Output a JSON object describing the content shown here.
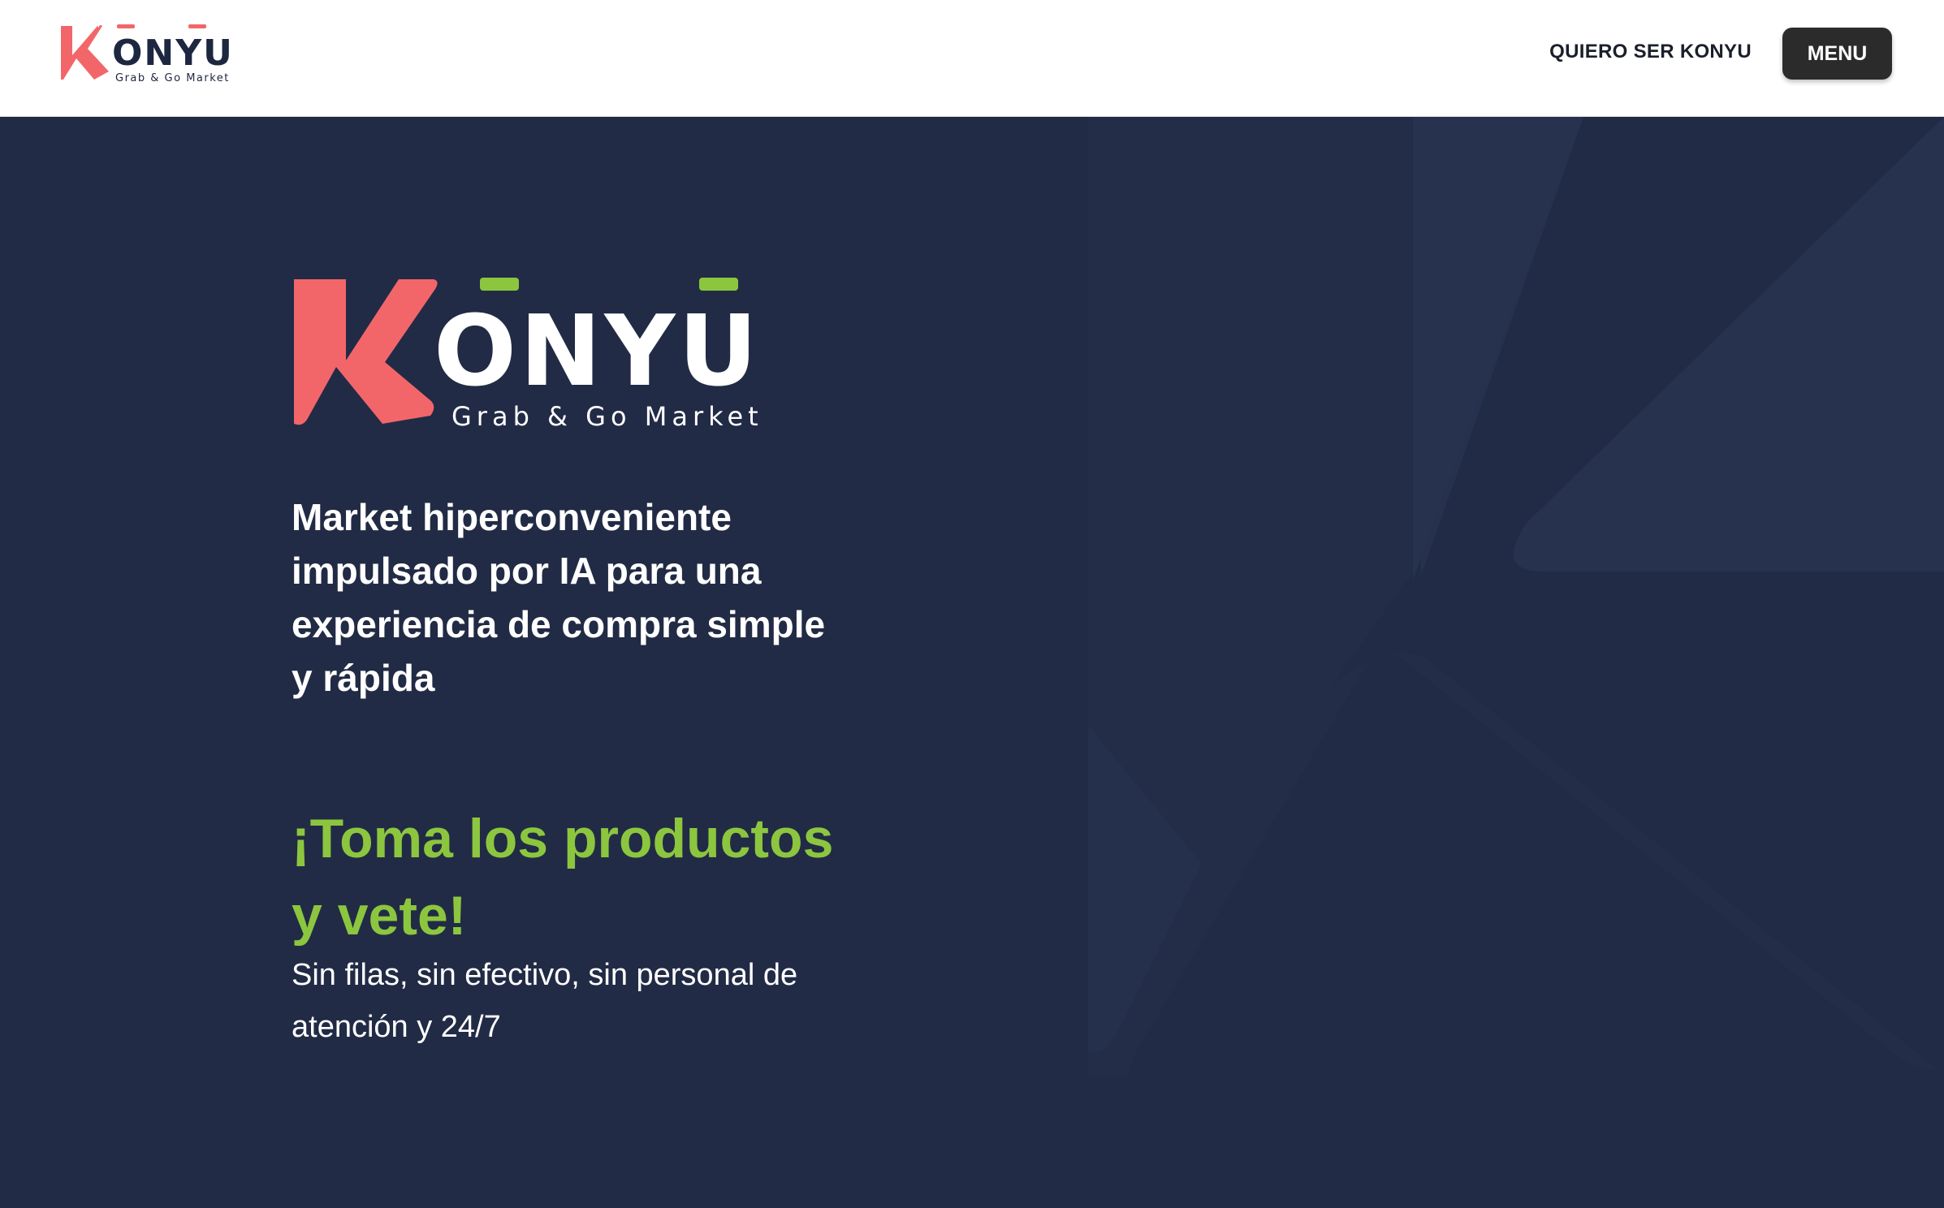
{
  "header": {
    "logo": {
      "wordmark": "ONYU",
      "subtitle": "Grab & Go Market",
      "accent": "#f2666a"
    },
    "nav_link": "QUIERO SER KONYU",
    "menu_label": "MENU"
  },
  "hero": {
    "logo": {
      "wordmark": "ONYU",
      "subtitle": "Grab & Go Market",
      "k_color": "#f2666a",
      "macron_color": "#8cc63f"
    },
    "tagline": "Market hiperconveniente impulsado por IA para una experiencia de compra simple y rápida",
    "cta_title": "¡Toma los productos y vete!",
    "cta_subtitle": "Sin filas, sin efectivo, sin personal de atención y 24/7"
  },
  "colors": {
    "background": "#222b45",
    "header_bg": "#ffffff",
    "accent_green": "#8cc63f",
    "accent_coral": "#f2666a",
    "menu_button": "#2b2b2b"
  }
}
